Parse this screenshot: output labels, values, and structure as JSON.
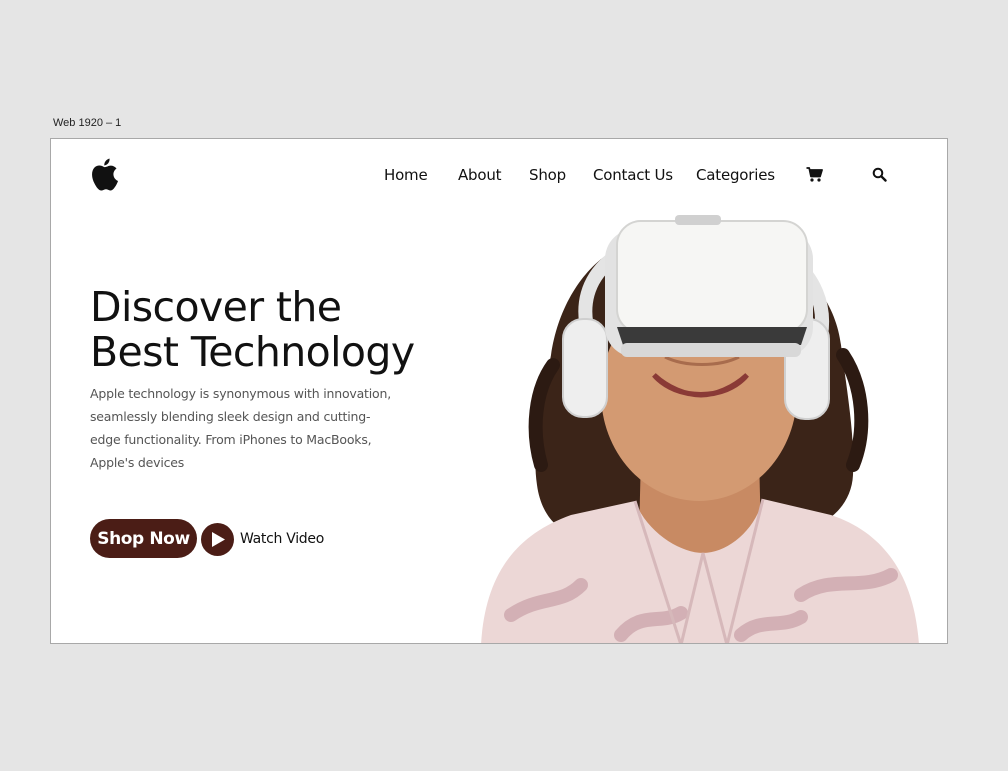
{
  "artboard": {
    "label": "Web 1920 – 1"
  },
  "header": {
    "logo_icon": "apple-logo-icon",
    "nav": [
      {
        "label": "Home"
      },
      {
        "label": "About"
      },
      {
        "label": "Shop"
      },
      {
        "label": "Contact Us"
      },
      {
        "label": "Categories"
      }
    ],
    "cart_icon": "cart-icon",
    "search_icon": "search-icon"
  },
  "hero": {
    "title_line1": "Discover the",
    "title_line2": "Best Technology",
    "description": "Apple technology is synonymous with innovation, seamlessly blending sleek design and cutting-edge functionality. From iPhones to MacBooks, Apple's devices",
    "primary_button": "Shop Now",
    "video_link": "Watch Video",
    "image": "woman-wearing-vr-headset-photo"
  },
  "colors": {
    "accent": "#4b1d16",
    "background": "#e5e5e5",
    "surface": "#ffffff"
  }
}
